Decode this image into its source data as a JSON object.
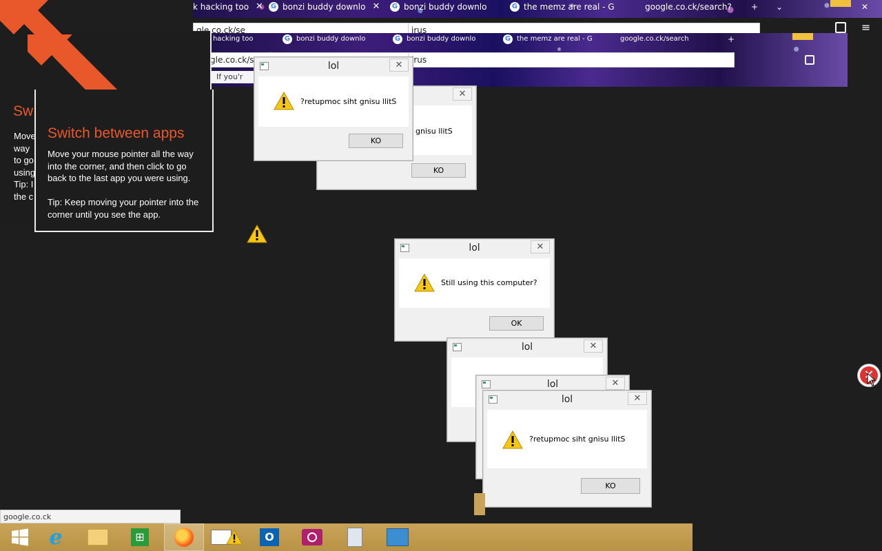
{
  "browser_back": {
    "tabs": [
      {
        "label": "k hacking too"
      },
      {
        "label": "bonzi buddy downlo"
      },
      {
        "label": "bonzi buddy downlo"
      },
      {
        "label": "the memz are real - G"
      },
      {
        "label": "google.co.ck/search?"
      }
    ],
    "url": "gle.co.ck/se",
    "search_text": "irus"
  },
  "browser_front": {
    "tabs": [
      {
        "label": "k hacking too"
      },
      {
        "label": "bonzi buddy downlo"
      },
      {
        "label": "bonzi buddy downlo"
      },
      {
        "label": "the memz are real - G"
      },
      {
        "label": "google.co.ck/search"
      }
    ],
    "url": "gle.co.ck/se",
    "search_text": "irus",
    "bookmark_text": "If you'r"
  },
  "tip_back": {
    "title": "Sw",
    "lines": [
      "Move",
      "way",
      "to go",
      "using",
      "Tip: I",
      "the c"
    ]
  },
  "tip_front": {
    "title": "Switch between apps",
    "text": "Move your mouse pointer all the way into the corner, and then click to go back to the last app you were using.",
    "tip": "Tip: Keep moving your pointer into the corner until you see the app."
  },
  "dialogs": {
    "d1": {
      "title": "lol",
      "message": "?retupmoc siht gnisu llitS",
      "button": "KO"
    },
    "d2": {
      "title": "",
      "message": "gnisu llitS",
      "button": "KO"
    },
    "d3": {
      "title": "lol",
      "message": "Still using this computer?",
      "button": "OK"
    },
    "d4": {
      "title": "lol"
    },
    "d5": {
      "title": "lol"
    },
    "d6": {
      "title": "lol",
      "message": "?retupmoc siht gnisu llitS",
      "button": "KO"
    }
  },
  "statusbar": {
    "text": "google.co.ck"
  },
  "taskbar": {
    "items": [
      {
        "name": "start"
      },
      {
        "name": "internet-explorer"
      },
      {
        "name": "file-explorer"
      },
      {
        "name": "store"
      },
      {
        "name": "firefox"
      },
      {
        "name": "task-window"
      },
      {
        "name": "outlook"
      },
      {
        "name": "camera"
      },
      {
        "name": "calculator"
      },
      {
        "name": "control-panel"
      }
    ]
  },
  "colors": {
    "desktop": "#1e1e1f",
    "tip_accent": "#e9582b",
    "taskbar": "#c8a45a",
    "warning": "#f5c518"
  }
}
